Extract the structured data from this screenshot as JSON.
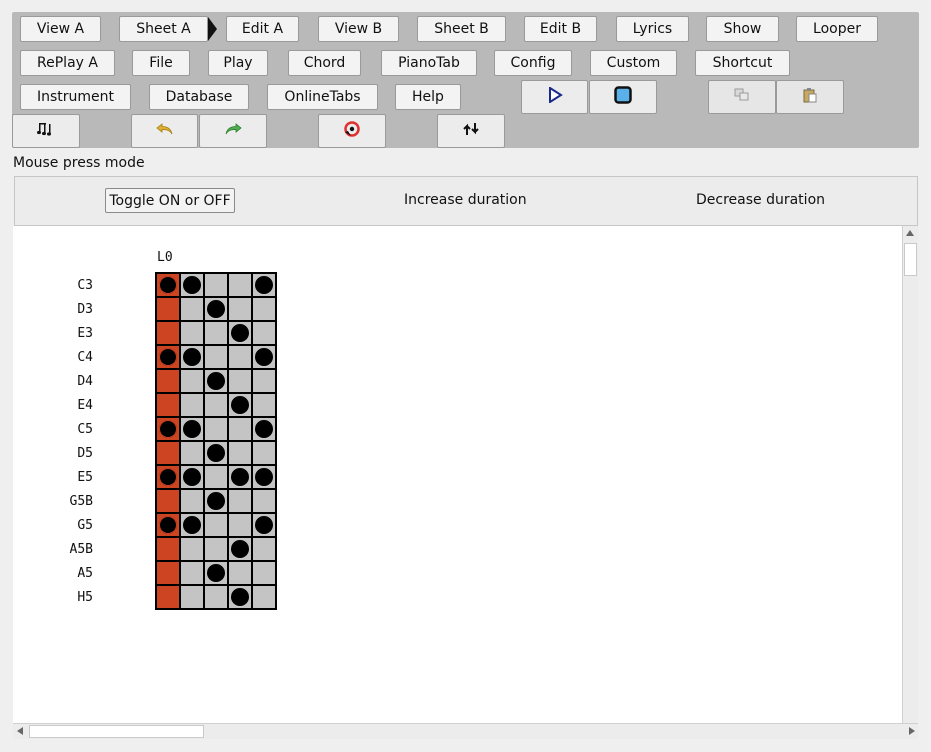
{
  "toolbar": {
    "row1": [
      "View A",
      "Sheet A",
      "Edit A",
      "View B",
      "Sheet B",
      "Edit B",
      "Lyrics",
      "Show",
      "Looper"
    ],
    "row2": [
      "RePlay A",
      "File",
      "Play",
      "Chord",
      "PianoTab",
      "Config",
      "Custom",
      "Shortcut"
    ],
    "row3": [
      "Instrument",
      "Database",
      "OnlineTabs",
      "Help"
    ],
    "icons": {
      "play": "play-icon",
      "stop": "stop-icon",
      "copy": "copy-icon",
      "paste": "paste-icon",
      "notes": "notes-icon",
      "undo": "undo-icon",
      "redo": "redo-icon",
      "loop": "loop-icon",
      "swap": "swap-icon"
    }
  },
  "mode": {
    "title": "Mouse press mode",
    "toggle": "Toggle ON or OFF",
    "increase": "Increase duration",
    "decrease": "Decrease duration"
  },
  "editor": {
    "layer": "L0",
    "rows": [
      "C3",
      "D3",
      "E3",
      "C4",
      "D4",
      "E4",
      "C5",
      "D5",
      "E5",
      "G5B",
      "G5",
      "A5B",
      "A5",
      "H5"
    ],
    "pattern": [
      [
        1,
        1,
        0,
        0,
        1
      ],
      [
        0,
        0,
        1,
        0,
        0
      ],
      [
        0,
        0,
        0,
        1,
        0
      ],
      [
        1,
        1,
        0,
        0,
        1
      ],
      [
        0,
        0,
        1,
        0,
        0
      ],
      [
        0,
        0,
        0,
        1,
        0
      ],
      [
        1,
        1,
        0,
        0,
        1
      ],
      [
        0,
        0,
        1,
        0,
        0
      ],
      [
        1,
        1,
        0,
        1,
        1
      ],
      [
        0,
        0,
        1,
        0,
        0
      ],
      [
        1,
        1,
        0,
        0,
        1
      ],
      [
        0,
        0,
        0,
        1,
        0
      ],
      [
        0,
        0,
        1,
        0,
        0
      ],
      [
        0,
        0,
        0,
        1,
        0
      ]
    ],
    "cursor_column": 0
  },
  "colors": {
    "cursor": "#cc4422",
    "cell": "#c4c4c4",
    "play": "#1a2a8a",
    "stop": "#5ab0e8",
    "undo": "#e0b030",
    "redo": "#50b050",
    "loop": "#e03030"
  }
}
